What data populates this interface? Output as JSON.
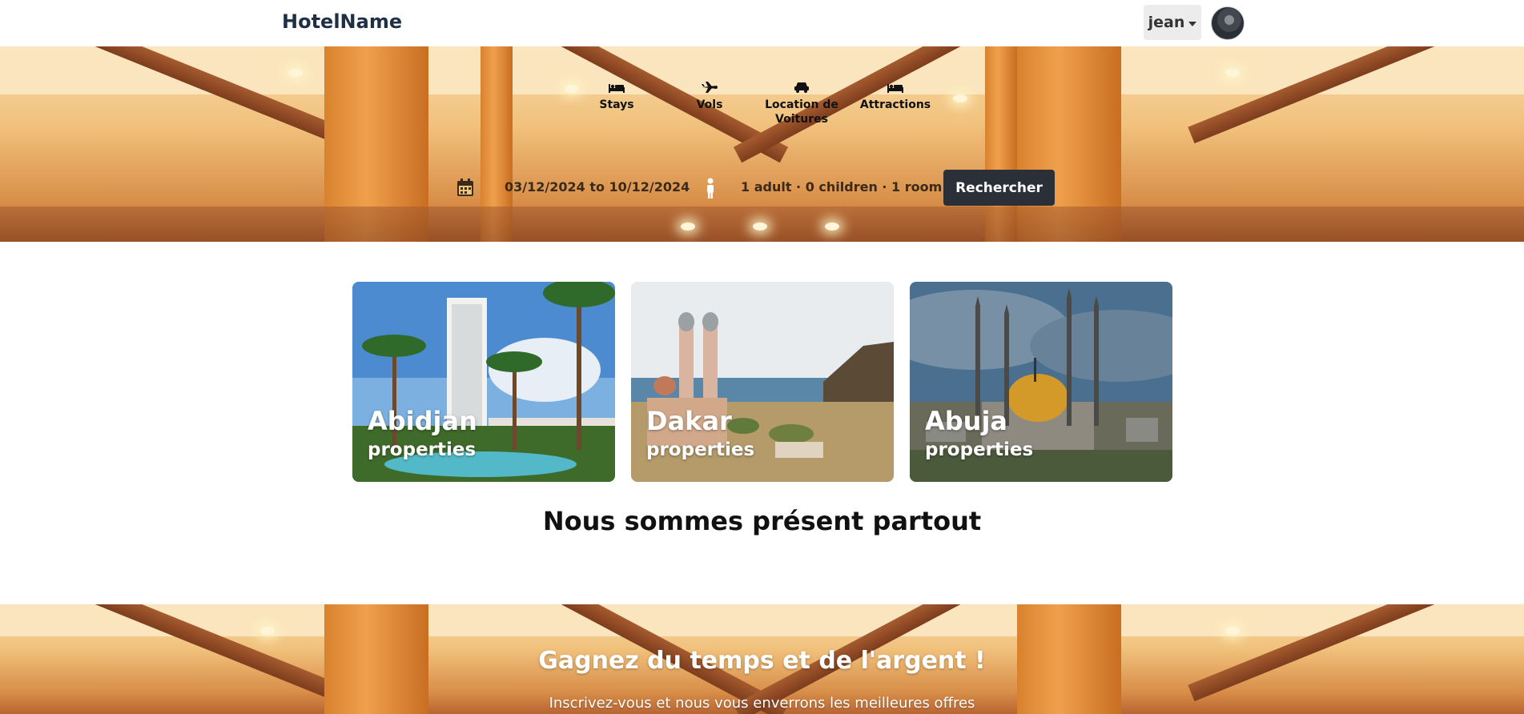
{
  "header": {
    "brand": "HotelName",
    "user_menu_label": "jean"
  },
  "hero": {
    "tabs": [
      {
        "label": "Stays",
        "icon": "bed-icon"
      },
      {
        "label": "Vols",
        "icon": "plane-icon"
      },
      {
        "label": "Location de Voitures",
        "icon": "car-icon"
      },
      {
        "label": "Attractions",
        "icon": "bed-icon"
      }
    ],
    "search": {
      "dates": "03/12/2024 to 10/12/2024",
      "guests": "1 adult · 0 children · 1 room",
      "button_label": "Rechercher"
    }
  },
  "cities": [
    {
      "name": "Abidjan",
      "sub": "properties"
    },
    {
      "name": "Dakar",
      "sub": "properties"
    },
    {
      "name": "Abuja",
      "sub": "properties"
    }
  ],
  "section_title": "Nous sommes présent partout",
  "promo": {
    "title": "Gagnez du temps et de l'argent !",
    "subtitle": "Inscrivez-vous et nous vous enverrons les meilleures offres"
  },
  "colors": {
    "brand": "#1f2f45",
    "button_dark": "#2b3038"
  }
}
